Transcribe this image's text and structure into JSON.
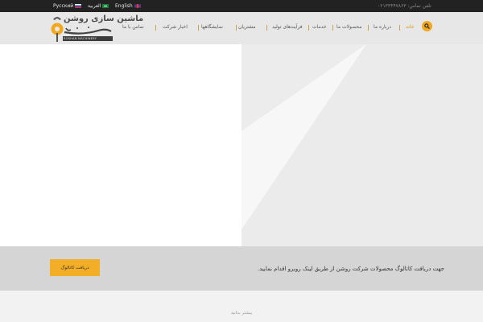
{
  "topbar": {
    "languages": [
      {
        "label": "Русский",
        "flag": "russia-flag-icon"
      },
      {
        "label": "العربية",
        "flag": "saudi-flag-icon"
      },
      {
        "label": "English",
        "flag": "uk-flag-icon"
      }
    ],
    "phone": "تلفن تماس: ۰۲۱۳۳۴۴۷۸۶۳"
  },
  "logo": {
    "title": "ماشین سازی روشن",
    "subtitle": "ROSHAN MACHINERY"
  },
  "nav": {
    "items": [
      {
        "label": "تماس با ما"
      },
      {
        "label": "اخبار شرکت"
      },
      {
        "label": "نمایشگاهها"
      },
      {
        "label": "مشتریان"
      },
      {
        "label": "فرآیندهای تولید"
      },
      {
        "label": "خدمات"
      },
      {
        "label": "محصولات ما"
      },
      {
        "label": "درباره ما"
      },
      {
        "label": "خانه"
      }
    ],
    "active": "خانه",
    "search_icon": "search-icon"
  },
  "catalog": {
    "text": "جهت دریافت کاتالوگ محصولات شرکت روشن از طریق لینک روبرو اقدام نمایید.",
    "button_label": "دریافت کاتالوگ"
  },
  "bottom": {
    "text": "بیشتر بدانید"
  },
  "colors": {
    "accent": "#f2ae27",
    "topbar": "#222222",
    "header": "#e7e7e7",
    "band": "#d5d5d5"
  }
}
